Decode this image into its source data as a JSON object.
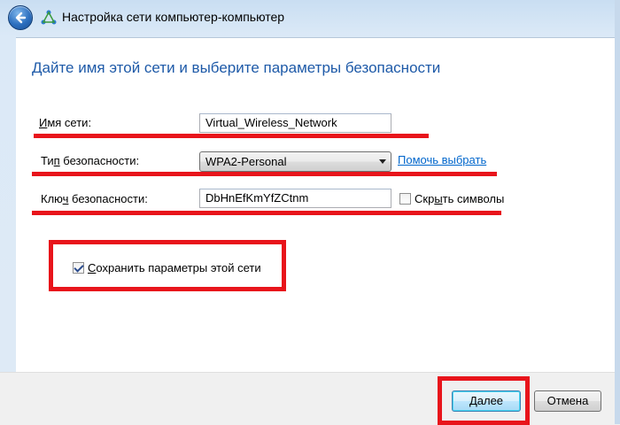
{
  "window": {
    "title": "Настройка сети компьютер-компьютер"
  },
  "main": {
    "heading": "Дайте имя этой сети и выберите параметры безопасности",
    "network_name": {
      "label_underlined": "И",
      "label_rest": "мя сети:",
      "value": "Virtual_Wireless_Network"
    },
    "security_type": {
      "label_before": "Ти",
      "label_underlined": "п",
      "label_after": " безопасности:",
      "selected": "WPA2-Personal",
      "help_link": "Помочь выбрать"
    },
    "security_key": {
      "label_before": "Клю",
      "label_underlined": "ч",
      "label_after": " безопасности:",
      "value": "DbHnEfKmYfZCtnm",
      "hide_chars_label_before": "Скр",
      "hide_chars_label_underlined": "ы",
      "hide_chars_label_after": "ть символы",
      "hide_chars_checked": false
    },
    "save_settings": {
      "label_underlined": "С",
      "label_rest": "охранить параметры этой сети",
      "checked": true
    }
  },
  "footer": {
    "next_label_underlined": "Д",
    "next_label_rest": "алее",
    "cancel_label": "Отмена"
  },
  "colors": {
    "annotation_red": "#e8141b",
    "heading_blue": "#1e5aa8",
    "link_blue": "#0066cc"
  }
}
